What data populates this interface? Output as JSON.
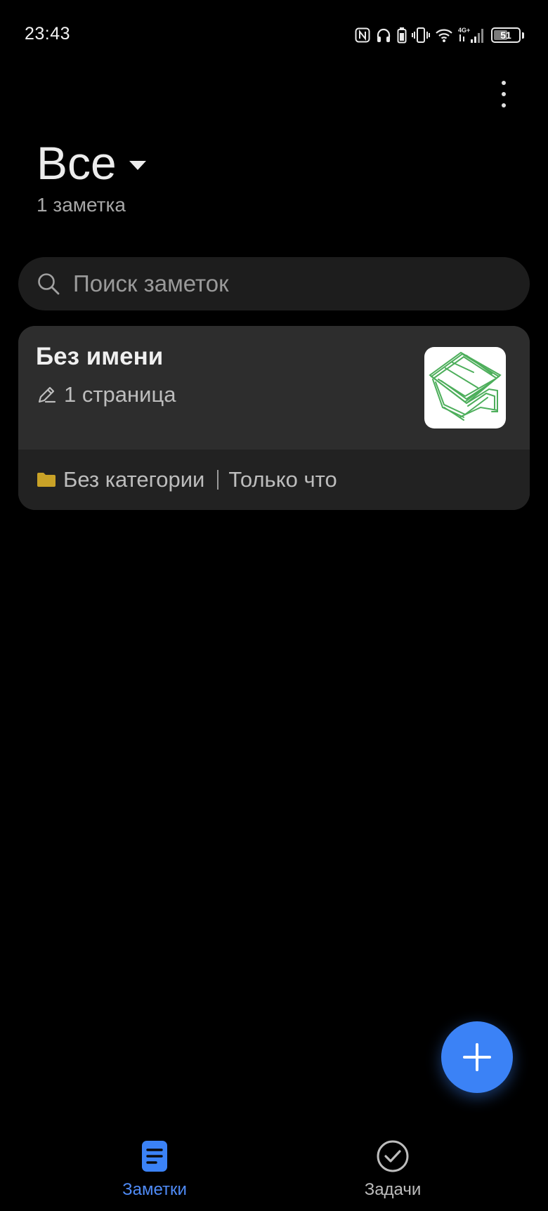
{
  "status_bar": {
    "time": "23:43",
    "battery_level": "51",
    "icons": [
      "nfc-icon",
      "headphones-icon",
      "battery-saver-icon",
      "vibrate-icon",
      "wifi-icon",
      "signal-4g-icon",
      "battery-icon"
    ]
  },
  "header": {
    "title": "Все",
    "note_count": "1 заметка"
  },
  "search": {
    "placeholder": "Поиск заметок"
  },
  "notes": [
    {
      "title": "Без имени",
      "pages": "1 страница",
      "category": "Без категории",
      "time": "Только что",
      "thumbnail": "green-sketch-thumbnail"
    }
  ],
  "bottom_nav": {
    "notes_label": "Заметки",
    "tasks_label": "Задачи",
    "active": "notes"
  },
  "colors": {
    "accent": "#3b82f6",
    "folder": "#c9a227",
    "background": "#000000",
    "card": "#2d2d2d"
  }
}
